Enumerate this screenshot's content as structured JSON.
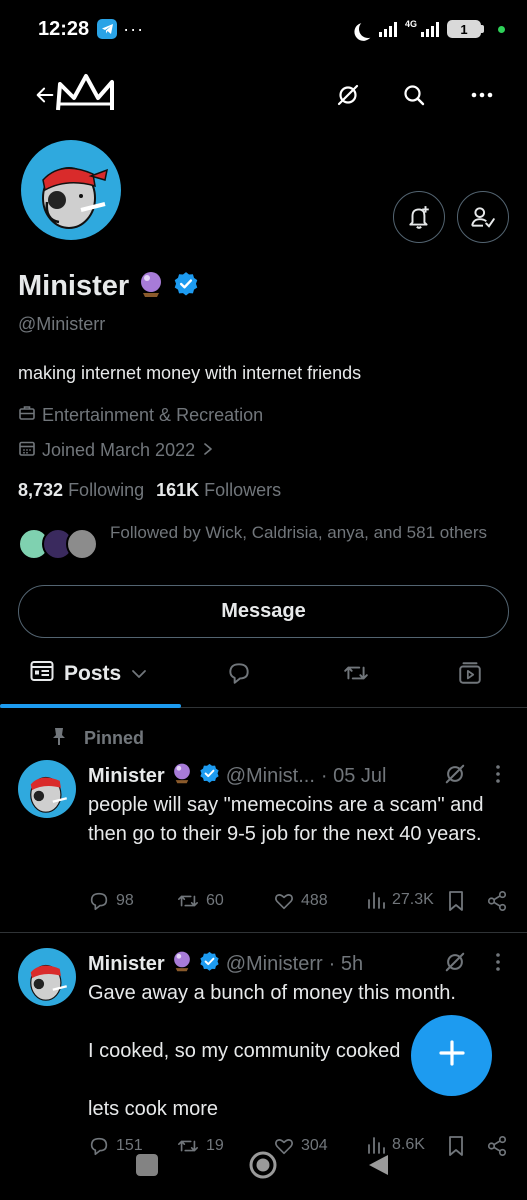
{
  "status_bar": {
    "time": "12:28",
    "dots": "···",
    "network": "4G",
    "battery": "1"
  },
  "header": {
    "back_icon": "back-arrow-icon",
    "grok_icon": "grok-icon",
    "search_icon": "search-icon",
    "more_icon": "more-icon"
  },
  "profile": {
    "name": "Minister",
    "handle": "@Ministerr",
    "bio": "making internet money with internet friends",
    "category": "Entertainment & Recreation",
    "joined": "Joined March 2022",
    "following_count": "8,732",
    "following_label": "Following",
    "followers_count": "161K",
    "followers_label": "Followers",
    "followed_by": "Followed by Wick, Caldrisia, anya, and 581 others",
    "message_label": "Message"
  },
  "tabs": {
    "posts_label": "Posts"
  },
  "pinned_label": "Pinned",
  "posts": [
    {
      "name": "Minister",
      "handle": "@Minist...",
      "time": "· 05 Jul",
      "text": "people will say \"memecoins are a scam\" and then go to their 9-5 job for the next 40 years.",
      "replies": "98",
      "reposts": "60",
      "likes": "488",
      "views": "27.3K"
    },
    {
      "name": "Minister",
      "handle": "@Ministerr",
      "time": "· 5h",
      "text": "Gave away a bunch of money this month.\n\nI cooked, so my community cooked\n\nlets cook more",
      "replies": "151",
      "reposts": "19",
      "likes": "304",
      "views": "8.6K"
    }
  ],
  "colors": {
    "accent": "#1d9bf0",
    "background": "#000000",
    "muted": "#71767b",
    "text": "#e7e9ea"
  }
}
